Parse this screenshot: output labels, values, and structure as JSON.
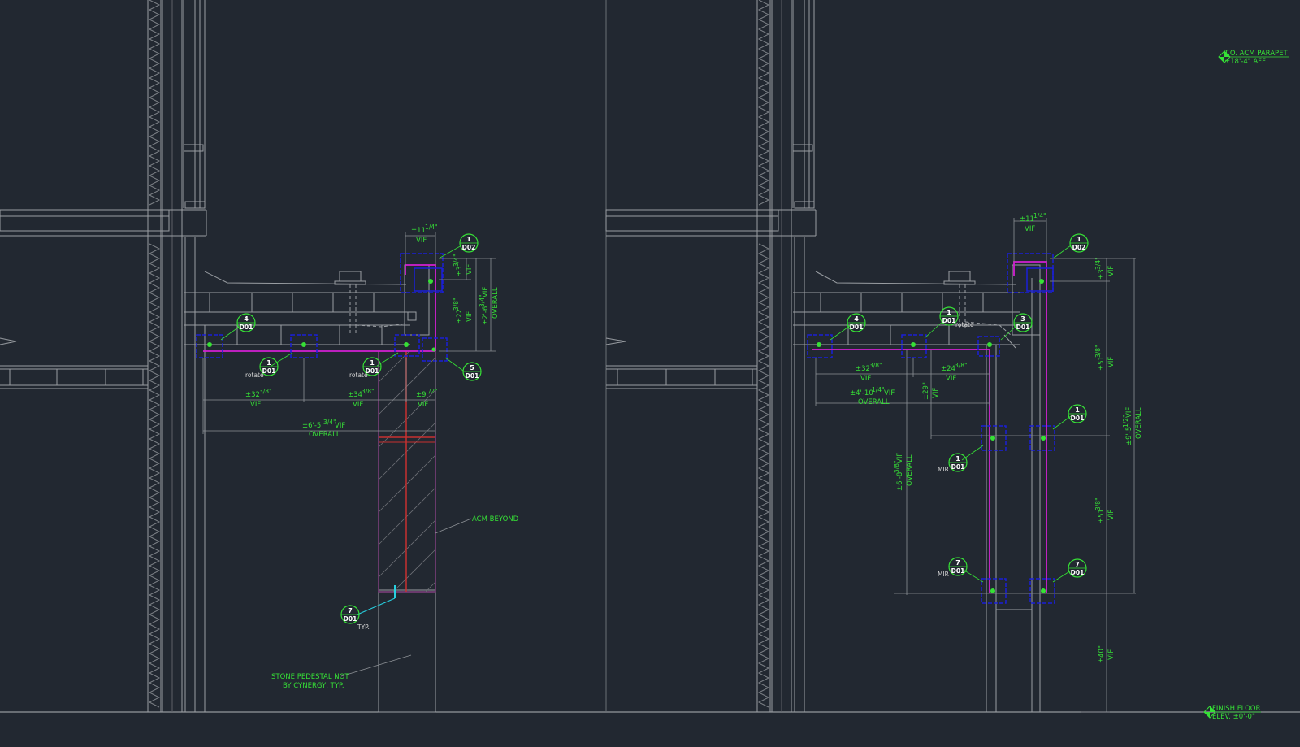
{
  "colors": {
    "background": "#222831",
    "linework": "#9a9ea3",
    "annotation": "#36e036",
    "highlight": "#d21fd2",
    "anchor_box": "#1a1fd8",
    "section_red": "#c83030",
    "cyan": "#28d0e0"
  },
  "left_view": {
    "tags": [
      {
        "num": "1",
        "ref": "D02"
      },
      {
        "num": "4",
        "ref": "D01"
      },
      {
        "num": "1",
        "ref": "D01"
      },
      {
        "num": "1",
        "ref": "D01"
      },
      {
        "num": "5",
        "ref": "D01"
      },
      {
        "num": "7",
        "ref": "D01"
      }
    ],
    "rotate_a": "rotate",
    "rotate_b": "rotate",
    "typ": "TYP.",
    "dims": {
      "top_w": "±11",
      "top_w_frac": "1/4\"",
      "top_vif": "VIF",
      "right_a": "±3",
      "right_a_frac": "3/4\"",
      "right_a_vif": "VIF",
      "right_b": "±22",
      "right_b_frac": "3/8\"",
      "right_b_vif": "VIF",
      "right_c": "±2'-6",
      "right_c_frac": "3/4\"",
      "right_c_vif": "VIF",
      "right_c_over": "OVERALL",
      "bot_1": "±32",
      "bot_1_frac": "3/8\"",
      "bot_1_vif": "VIF",
      "bot_2": "±34",
      "bot_2_frac": "3/8\"",
      "bot_2_vif": "VIF",
      "bot_3": "±9",
      "bot_3_frac": "1/2\"",
      "bot_3_vif": "VIF",
      "overall": "±6'-5",
      "overall_frac": "3/4\"",
      "overall_vif": "VIF",
      "overall_label": "OVERALL"
    },
    "notes": {
      "acm_beyond": "ACM BEYOND",
      "stone_1": "STONE PEDESTAL NOT",
      "stone_2": "BY CYNERGY, TYP."
    }
  },
  "right_view": {
    "tags": [
      {
        "num": "1",
        "ref": "D02"
      },
      {
        "num": "4",
        "ref": "D01"
      },
      {
        "num": "1",
        "ref": "D01"
      },
      {
        "num": "3",
        "ref": "D01"
      },
      {
        "num": "1",
        "ref": "D01"
      },
      {
        "num": "1",
        "ref": "D01"
      },
      {
        "num": "7",
        "ref": "D01"
      },
      {
        "num": "7",
        "ref": "D01"
      }
    ],
    "rotate": "rotate",
    "mir_a": "MIR",
    "mir_b": "MIR",
    "dims": {
      "top_w": "±11",
      "top_w_frac": "1/4\"",
      "top_vif": "VIF",
      "right_a": "±3",
      "right_a_frac": "3/4\"",
      "right_a_vif": "VIF",
      "h_1": "±32",
      "h_1_frac": "3/8\"",
      "h_1_vif": "VIF",
      "h_2": "±24",
      "h_2_frac": "3/8\"",
      "h_2_vif": "VIF",
      "h_over": "±4'-10",
      "h_over_frac": "1/4\"",
      "h_over_vif": "VIF",
      "h_over_label": "OVERALL",
      "v_29": "±29\"",
      "v_29_vif": "VIF",
      "v_left": "±6'-8",
      "v_left_frac": "3/8\"",
      "v_left_vif": "VIF",
      "v_left_over": "OVERALL",
      "v_51a": "±51",
      "v_51a_frac": "3/8\"",
      "v_51a_vif": "VIF",
      "v_51b": "±51",
      "v_51b_frac": "3/8\"",
      "v_51b_vif": "VIF",
      "v_right": "±9'-5",
      "v_right_frac": "1/2\"",
      "v_right_vif": "VIF",
      "v_right_over": "OVERALL",
      "v_40": "±40\"",
      "v_40_vif": "VIF"
    },
    "elev_top_1": "T.O. ACM PARAPET",
    "elev_top_2": "±18'-4\" AFF",
    "elev_bot_1": "FINISH FLOOR",
    "elev_bot_2": "ELEV. ±0'-0\""
  }
}
